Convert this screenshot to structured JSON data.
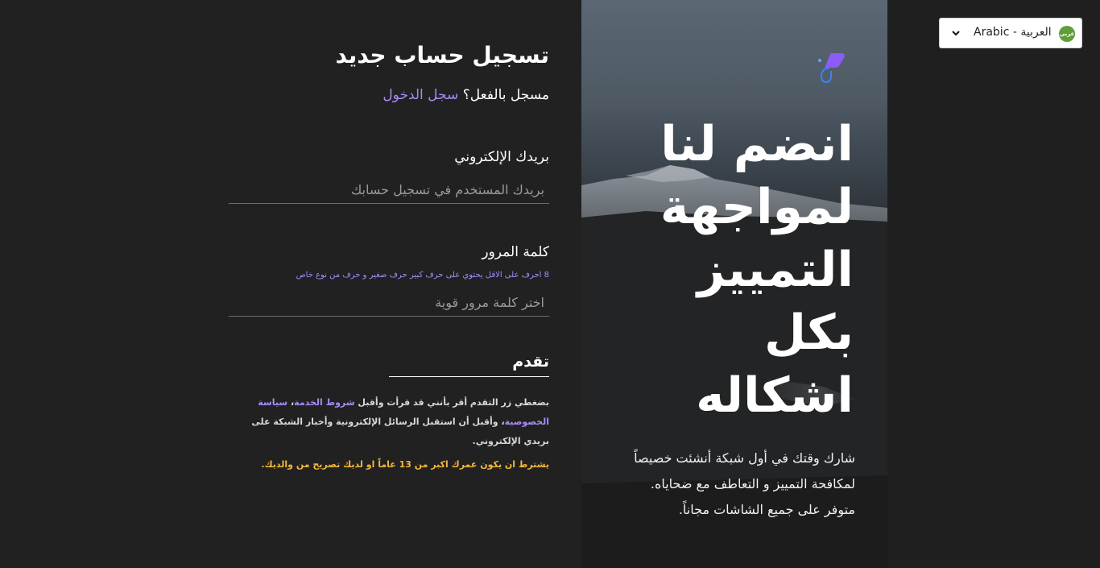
{
  "language_selector": {
    "label": "Arabic - العربية",
    "flag_text": "عربي",
    "chevron_icon": "chevron-down-icon",
    "flag_icon": "arabic-flag-icon"
  },
  "hero": {
    "logo_icon": "brand-logo-icon",
    "title_lines": [
      "انضم لنا",
      "لمواجهة",
      "التمييز",
      "بكل",
      "اشكاله"
    ],
    "description_lines": [
      "شارك وقتك في أول شبكة أنشئت خصيصاً",
      "لمكافحة التمييز و التعاطف مع ضحاياه.",
      "متوفر على جميع الشاشات مجاناً."
    ]
  },
  "form": {
    "title": "تسجيل حساب جديد",
    "already_registered": "مسجل بالفعل؟",
    "login_link": "سجل الدخول",
    "email": {
      "label": "بريدك الإلكتروني",
      "placeholder": "بريدك المستخدم في تسجيل حسابك",
      "value": ""
    },
    "password": {
      "label": "كلمة المرور",
      "hint": "8 احرف على الاقل يحتوي على حرف كبير حرف صغير و حرف من نوع خاص",
      "placeholder": "اختر كلمة مرور قوية",
      "value": ""
    },
    "submit_label": "تقدم",
    "terms": {
      "prefix": "بضغطي زر التقدم أقر بأنني قد قرأت وأقبل ",
      "terms_link": "شروط الخدمة",
      "separator": "، ",
      "privacy_link": "سياسة الخصوصية",
      "suffix": "، وأقبل أن استقبل الرسائل الإلكترونية وأخبار الشبكة على بريدي الإلكتروني."
    },
    "age_note": "يشترط ان يكون عمرك اكبر من 13 عاماً او لديك تصريح من والديك."
  },
  "colors": {
    "background": "#212121",
    "accent": "#a78bfa",
    "warning": "#f5b73b"
  }
}
